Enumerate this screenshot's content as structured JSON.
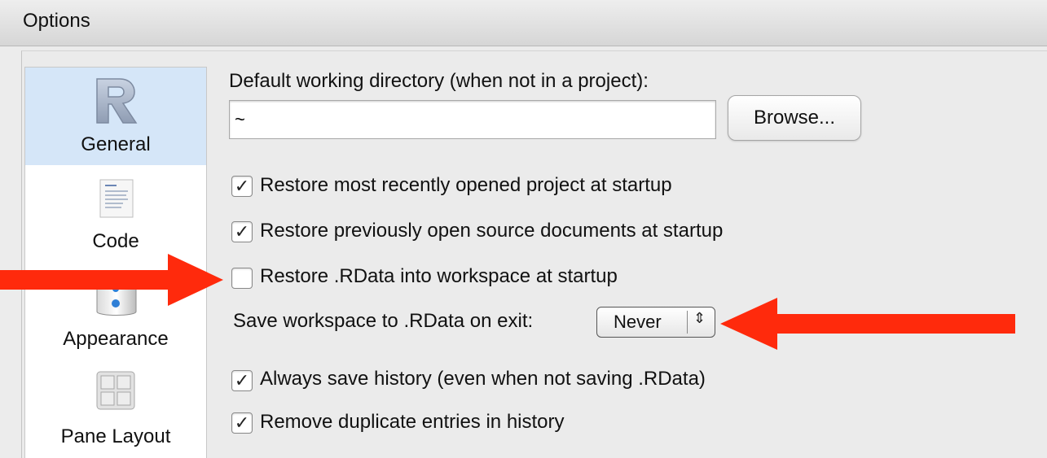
{
  "window": {
    "title": "Options"
  },
  "sidebar": {
    "items": [
      {
        "label": "General",
        "icon": "r-logo-icon",
        "selected": true
      },
      {
        "label": "Code",
        "icon": "code-document-icon",
        "selected": false
      },
      {
        "label": "Appearance",
        "icon": "appearance-icon",
        "selected": false
      },
      {
        "label": "Pane Layout",
        "icon": "pane-layout-icon",
        "selected": false
      }
    ]
  },
  "general": {
    "working_dir_label": "Default working directory (when not in a project):",
    "working_dir_value": "~",
    "browse_label": "Browse...",
    "checkboxes": [
      {
        "label": "Restore most recently opened project at startup",
        "checked": true
      },
      {
        "label": "Restore previously open source documents at startup",
        "checked": true
      },
      {
        "label": "Restore .RData into workspace at startup",
        "checked": false
      },
      {
        "label": "Always save history (even when not saving .RData)",
        "checked": true
      },
      {
        "label": "Remove duplicate entries in history",
        "checked": true
      }
    ],
    "save_workspace_label": "Save workspace to .RData on exit:",
    "save_workspace_value": "Never"
  },
  "annotations": {
    "arrow_color": "#ff2a0c"
  },
  "check_glyph": "✓"
}
